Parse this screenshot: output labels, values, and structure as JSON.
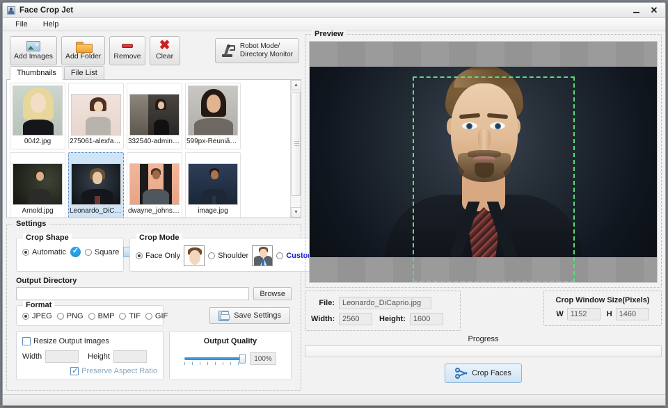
{
  "window": {
    "title": "Face Crop Jet",
    "app_icon": "app-photo-icon",
    "minimize_label": "",
    "close_label": "✕"
  },
  "menubar": {
    "items": [
      {
        "label": "File"
      },
      {
        "label": "Help"
      }
    ]
  },
  "toolbar": {
    "buttons": [
      {
        "label": "Add Images",
        "icon": "image-icon"
      },
      {
        "label": "Add Folder",
        "icon": "folder-icon"
      },
      {
        "label": "Remove",
        "icon": "minus-icon"
      },
      {
        "label": "Clear",
        "icon": "red-x-icon"
      }
    ],
    "robot_mode": {
      "line1": "Robot Mode/",
      "line2": "Directory Monitor",
      "icon": "robot-arm-icon"
    }
  },
  "tabs": [
    {
      "label": "Thumbnails",
      "active": true
    },
    {
      "label": "File List",
      "active": false
    }
  ],
  "thumbnails": {
    "items": [
      {
        "name": "0042.jpg",
        "selected": false
      },
      {
        "name": "275061-alexfas...",
        "selected": false
      },
      {
        "name": "332540-admin.jpg",
        "selected": false
      },
      {
        "name": "599px-Reunião...",
        "selected": false
      },
      {
        "name": "Arnold.jpg",
        "selected": false
      },
      {
        "name": "Leonardo_DiCa...",
        "selected": true
      },
      {
        "name": "dwayne_johnso...",
        "selected": false
      },
      {
        "name": "image.jpg",
        "selected": false
      }
    ],
    "clipped_row_count": 4,
    "scrollbar": {
      "up_arrow": "▲",
      "down_arrow": "▼"
    }
  },
  "settings": {
    "title": "Settings",
    "crop_shape": {
      "title": "Crop Shape",
      "options": [
        {
          "label": "Automatic",
          "selected": true,
          "badge": "blue-check-badge"
        },
        {
          "label": "Square",
          "selected": false,
          "badge": "square-swatch"
        }
      ]
    },
    "crop_mode": {
      "title": "Crop Mode",
      "options": [
        {
          "label": "Face Only",
          "selected": true,
          "preview": "face-only-thumbnail"
        },
        {
          "label": "Shoulder",
          "selected": false,
          "preview": "shoulder-thumbnail"
        },
        {
          "label": "Custom",
          "selected": false,
          "preview": ""
        }
      ]
    },
    "output_directory": {
      "title": "Output Directory",
      "value": "",
      "placeholder": "",
      "browse_label": "Browse"
    },
    "format": {
      "title": "Format",
      "options": [
        {
          "label": "JPEG",
          "selected": true
        },
        {
          "label": "PNG",
          "selected": false
        },
        {
          "label": "BMP",
          "selected": false
        },
        {
          "label": "TIF",
          "selected": false
        },
        {
          "label": "GIF",
          "selected": false
        }
      ]
    },
    "save_settings": {
      "label": "Save Settings",
      "icon": "floppy-disk-icon"
    },
    "resize": {
      "checkbox_label": "Resize Output Images",
      "checked": false,
      "width_label": "Width",
      "width_value": "",
      "height_label": "Height",
      "height_value": "",
      "preserve_label": "Preserve Aspect Ratio",
      "preserve_checked": true
    },
    "output_quality": {
      "title": "Output Quality",
      "value": "100%",
      "percent": 100
    }
  },
  "preview": {
    "title": "Preview",
    "image_alt": "Leonardo DiCaprio portrait",
    "crop_rect_color": "#55e07a",
    "letterbox_color": "#9b9b9b"
  },
  "file_info": {
    "file_label": "File:",
    "file_value": "Leonardo_DiCaprio.jpg",
    "width_label": "Width:",
    "width_value": "2560",
    "height_label": "Height:",
    "height_value": "1600"
  },
  "crop_window_size": {
    "title": "Crop Window Size(Pixels)",
    "w_label": "W",
    "w_value": "1152",
    "h_label": "H",
    "h_value": "1460"
  },
  "progress": {
    "label": "Progress",
    "percent": 0
  },
  "crop_faces_button": {
    "label": "Crop Faces",
    "icon": "scissors-icon"
  }
}
